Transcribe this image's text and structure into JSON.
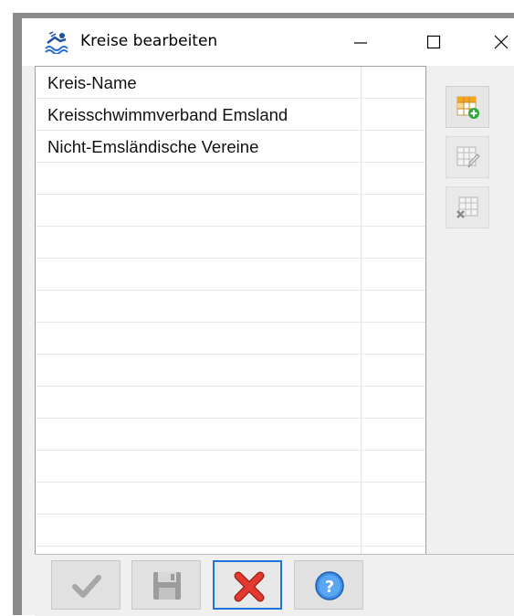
{
  "window": {
    "title": "Kreise bearbeiten",
    "icons": {
      "app": "swimmer-icon",
      "minimize": "minimize-icon",
      "maximize": "maximize-icon",
      "close": "close-icon"
    }
  },
  "grid": {
    "header": "Kreis-Name",
    "rows": [
      "Kreisschwimmverband Emsland",
      "Nicht-Emsländische Vereine"
    ]
  },
  "toolbar": {
    "add": {
      "icon": "grid-add-icon",
      "enabled": true
    },
    "edit": {
      "icon": "grid-edit-icon",
      "enabled": false
    },
    "delete": {
      "icon": "grid-delete-icon",
      "enabled": false
    }
  },
  "bottom": {
    "ok": {
      "icon": "checkmark-icon",
      "enabled": false
    },
    "save": {
      "icon": "save-icon",
      "enabled": false
    },
    "cancel": {
      "icon": "red-x-icon",
      "enabled": true,
      "focused": true
    },
    "help": {
      "icon": "help-icon",
      "enabled": true
    }
  },
  "colors": {
    "accent": "#1e73d8",
    "cancel_red": "#e23a2e",
    "add_green": "#2fa83a",
    "grid_orange": "#f5a623"
  }
}
